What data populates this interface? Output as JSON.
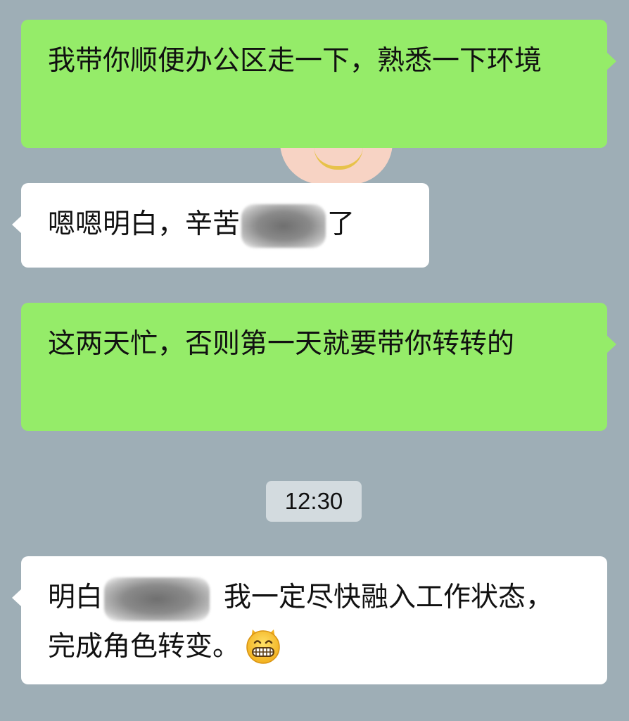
{
  "messages": [
    {
      "id": "m1",
      "side": "sent",
      "text": "我带你顺便办公区走一下，熟悉一下环境"
    },
    {
      "id": "m2",
      "side": "received",
      "text_before": "嗯嗯明白，辛苦",
      "text_after": "了"
    },
    {
      "id": "m3",
      "side": "sent",
      "text": "这两天忙，否则第一天就要带你转转的"
    },
    {
      "id": "m4",
      "side": "received",
      "text_before": "明白",
      "text_after": "我一定尽快融入工作状态，完成角色转变。",
      "emoji": "grinning-face-emoji"
    }
  ],
  "timestamp": "12:30",
  "colors": {
    "background": "#9eaeb6",
    "sent_bubble": "#95ec69",
    "received_bubble": "#ffffff",
    "timestamp_bg": "#d3dbdf"
  }
}
